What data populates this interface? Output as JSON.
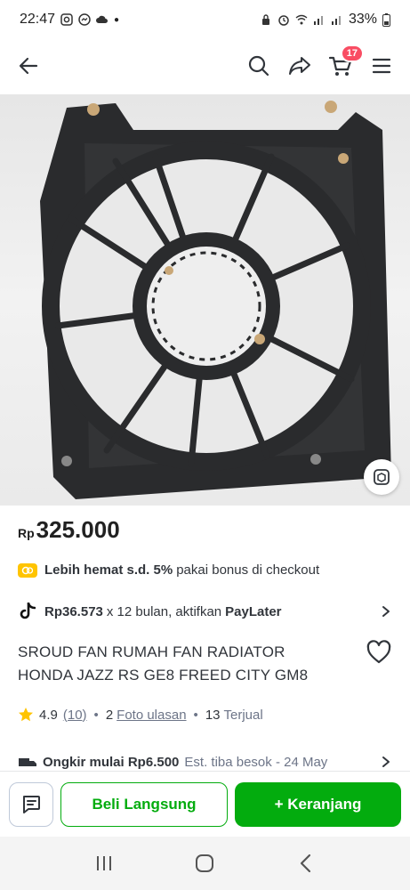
{
  "status_bar": {
    "time": "22:47",
    "battery": "33%"
  },
  "header": {
    "cart_count": "17",
    "icons": [
      "back-arrow-icon",
      "search-icon",
      "share-icon",
      "cart-icon",
      "menu-icon"
    ]
  },
  "product": {
    "price_currency": "Rp",
    "price_value": "325.000",
    "promo_strong": "Lebih hemat s.d. 5%",
    "promo_rest": "pakai bonus di checkout",
    "paylater_amount": "Rp36.573",
    "paylater_terms": "x 12 bulan, aktifkan",
    "paylater_name": "PayLater",
    "title": "SROUD FAN RUMAH FAN RADIATOR HONDA JAZZ RS GE8 FREED CITY GM8",
    "rating": "4.9",
    "rating_count": "(10)",
    "bullet": "•",
    "photo_count": "2",
    "photo_label": "Foto ulasan",
    "sold_count": "13",
    "sold_label": "Terjual",
    "shipping_strong": "Ongkir mulai Rp6.500",
    "shipping_eta": "Est. tiba besok - 24 May"
  },
  "actions": {
    "buy_now": "Beli Langsung",
    "add_cart": "+ Keranjang"
  },
  "colors": {
    "brand_green": "#03ac0e",
    "badge": "#f94d63",
    "star": "#ffc400"
  }
}
